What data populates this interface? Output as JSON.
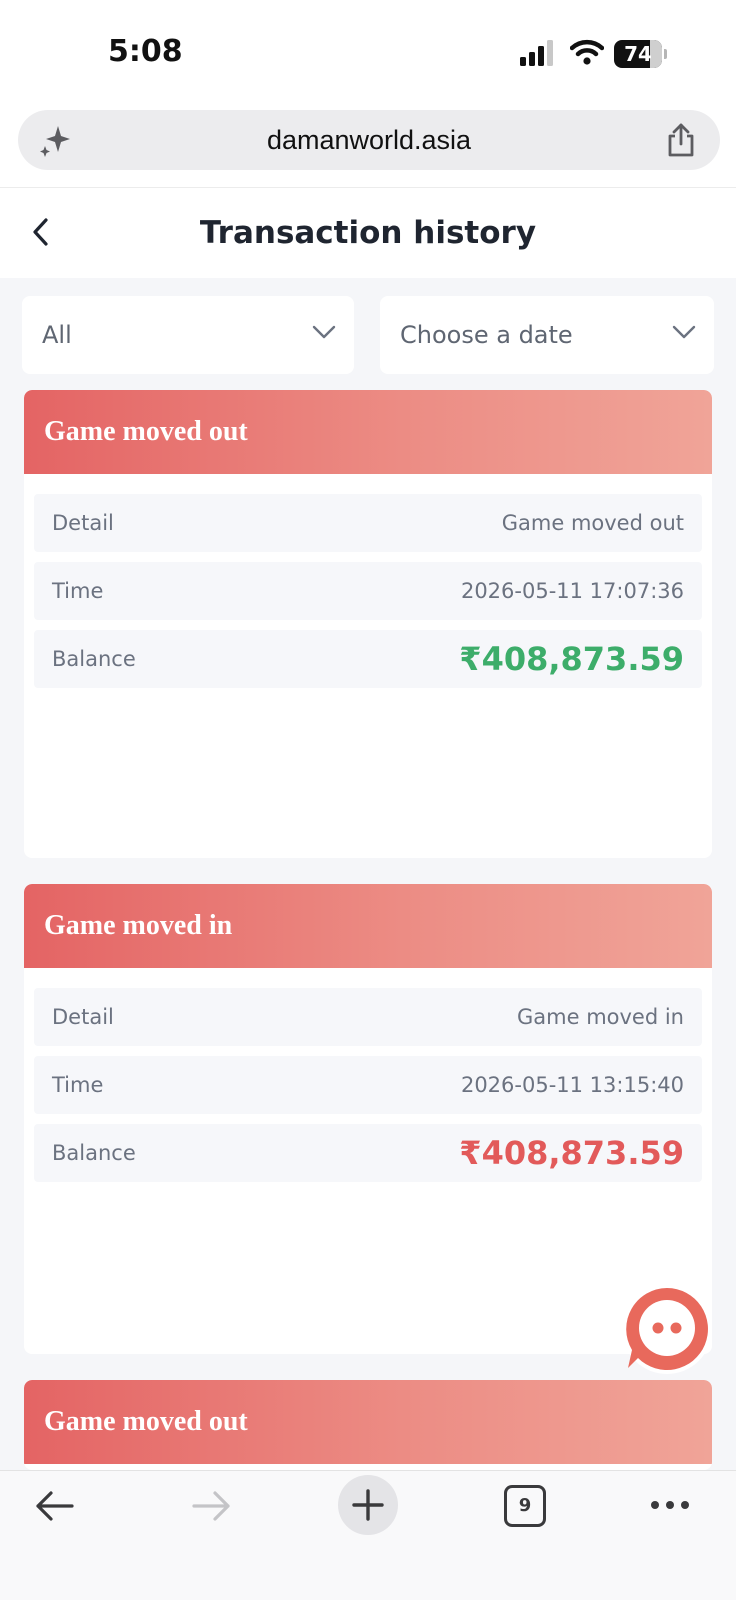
{
  "status_bar": {
    "time": "5:08",
    "battery": "74",
    "battery_level": 0.74
  },
  "browser": {
    "url": "damanworld.asia",
    "tab_count": "9"
  },
  "header": {
    "title": "Transaction history"
  },
  "filters": {
    "type": "All",
    "date": "Choose a date"
  },
  "transactions": [
    {
      "title": "Game moved out",
      "detail_label": "Detail",
      "detail": "Game moved out",
      "time_label": "Time",
      "time": "2026-05-11 17:07:36",
      "balance_label": "Balance",
      "balance": "₹408,873.59"
    },
    {
      "title": "Game moved in",
      "detail_label": "Detail",
      "detail": "Game moved in",
      "time_label": "Time",
      "time": "2026-05-11 13:15:40",
      "balance_label": "Balance",
      "balance": "₹408,873.59"
    },
    {
      "title": "Game moved out"
    }
  ],
  "colors": {
    "header_gradient_start": "#e46464",
    "header_gradient_end": "#f0a498",
    "amount_positive": "#3dad6a",
    "amount_negative": "#e25a5a"
  }
}
